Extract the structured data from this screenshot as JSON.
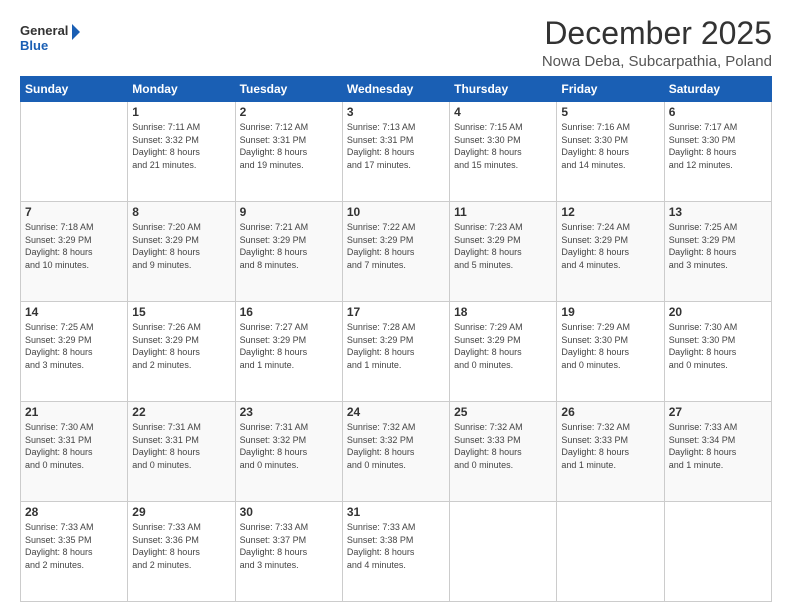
{
  "logo": {
    "line1": "General",
    "line2": "Blue"
  },
  "title": "December 2025",
  "subtitle": "Nowa Deba, Subcarpathia, Poland",
  "header_days": [
    "Sunday",
    "Monday",
    "Tuesday",
    "Wednesday",
    "Thursday",
    "Friday",
    "Saturday"
  ],
  "weeks": [
    [
      {
        "day": "",
        "info": ""
      },
      {
        "day": "1",
        "info": "Sunrise: 7:11 AM\nSunset: 3:32 PM\nDaylight: 8 hours\nand 21 minutes."
      },
      {
        "day": "2",
        "info": "Sunrise: 7:12 AM\nSunset: 3:31 PM\nDaylight: 8 hours\nand 19 minutes."
      },
      {
        "day": "3",
        "info": "Sunrise: 7:13 AM\nSunset: 3:31 PM\nDaylight: 8 hours\nand 17 minutes."
      },
      {
        "day": "4",
        "info": "Sunrise: 7:15 AM\nSunset: 3:30 PM\nDaylight: 8 hours\nand 15 minutes."
      },
      {
        "day": "5",
        "info": "Sunrise: 7:16 AM\nSunset: 3:30 PM\nDaylight: 8 hours\nand 14 minutes."
      },
      {
        "day": "6",
        "info": "Sunrise: 7:17 AM\nSunset: 3:30 PM\nDaylight: 8 hours\nand 12 minutes."
      }
    ],
    [
      {
        "day": "7",
        "info": "Sunrise: 7:18 AM\nSunset: 3:29 PM\nDaylight: 8 hours\nand 10 minutes."
      },
      {
        "day": "8",
        "info": "Sunrise: 7:20 AM\nSunset: 3:29 PM\nDaylight: 8 hours\nand 9 minutes."
      },
      {
        "day": "9",
        "info": "Sunrise: 7:21 AM\nSunset: 3:29 PM\nDaylight: 8 hours\nand 8 minutes."
      },
      {
        "day": "10",
        "info": "Sunrise: 7:22 AM\nSunset: 3:29 PM\nDaylight: 8 hours\nand 7 minutes."
      },
      {
        "day": "11",
        "info": "Sunrise: 7:23 AM\nSunset: 3:29 PM\nDaylight: 8 hours\nand 5 minutes."
      },
      {
        "day": "12",
        "info": "Sunrise: 7:24 AM\nSunset: 3:29 PM\nDaylight: 8 hours\nand 4 minutes."
      },
      {
        "day": "13",
        "info": "Sunrise: 7:25 AM\nSunset: 3:29 PM\nDaylight: 8 hours\nand 3 minutes."
      }
    ],
    [
      {
        "day": "14",
        "info": "Sunrise: 7:25 AM\nSunset: 3:29 PM\nDaylight: 8 hours\nand 3 minutes."
      },
      {
        "day": "15",
        "info": "Sunrise: 7:26 AM\nSunset: 3:29 PM\nDaylight: 8 hours\nand 2 minutes."
      },
      {
        "day": "16",
        "info": "Sunrise: 7:27 AM\nSunset: 3:29 PM\nDaylight: 8 hours\nand 1 minute."
      },
      {
        "day": "17",
        "info": "Sunrise: 7:28 AM\nSunset: 3:29 PM\nDaylight: 8 hours\nand 1 minute."
      },
      {
        "day": "18",
        "info": "Sunrise: 7:29 AM\nSunset: 3:29 PM\nDaylight: 8 hours\nand 0 minutes."
      },
      {
        "day": "19",
        "info": "Sunrise: 7:29 AM\nSunset: 3:30 PM\nDaylight: 8 hours\nand 0 minutes."
      },
      {
        "day": "20",
        "info": "Sunrise: 7:30 AM\nSunset: 3:30 PM\nDaylight: 8 hours\nand 0 minutes."
      }
    ],
    [
      {
        "day": "21",
        "info": "Sunrise: 7:30 AM\nSunset: 3:31 PM\nDaylight: 8 hours\nand 0 minutes."
      },
      {
        "day": "22",
        "info": "Sunrise: 7:31 AM\nSunset: 3:31 PM\nDaylight: 8 hours\nand 0 minutes."
      },
      {
        "day": "23",
        "info": "Sunrise: 7:31 AM\nSunset: 3:32 PM\nDaylight: 8 hours\nand 0 minutes."
      },
      {
        "day": "24",
        "info": "Sunrise: 7:32 AM\nSunset: 3:32 PM\nDaylight: 8 hours\nand 0 minutes."
      },
      {
        "day": "25",
        "info": "Sunrise: 7:32 AM\nSunset: 3:33 PM\nDaylight: 8 hours\nand 0 minutes."
      },
      {
        "day": "26",
        "info": "Sunrise: 7:32 AM\nSunset: 3:33 PM\nDaylight: 8 hours\nand 1 minute."
      },
      {
        "day": "27",
        "info": "Sunrise: 7:33 AM\nSunset: 3:34 PM\nDaylight: 8 hours\nand 1 minute."
      }
    ],
    [
      {
        "day": "28",
        "info": "Sunrise: 7:33 AM\nSunset: 3:35 PM\nDaylight: 8 hours\nand 2 minutes."
      },
      {
        "day": "29",
        "info": "Sunrise: 7:33 AM\nSunset: 3:36 PM\nDaylight: 8 hours\nand 2 minutes."
      },
      {
        "day": "30",
        "info": "Sunrise: 7:33 AM\nSunset: 3:37 PM\nDaylight: 8 hours\nand 3 minutes."
      },
      {
        "day": "31",
        "info": "Sunrise: 7:33 AM\nSunset: 3:38 PM\nDaylight: 8 hours\nand 4 minutes."
      },
      {
        "day": "",
        "info": ""
      },
      {
        "day": "",
        "info": ""
      },
      {
        "day": "",
        "info": ""
      }
    ]
  ]
}
